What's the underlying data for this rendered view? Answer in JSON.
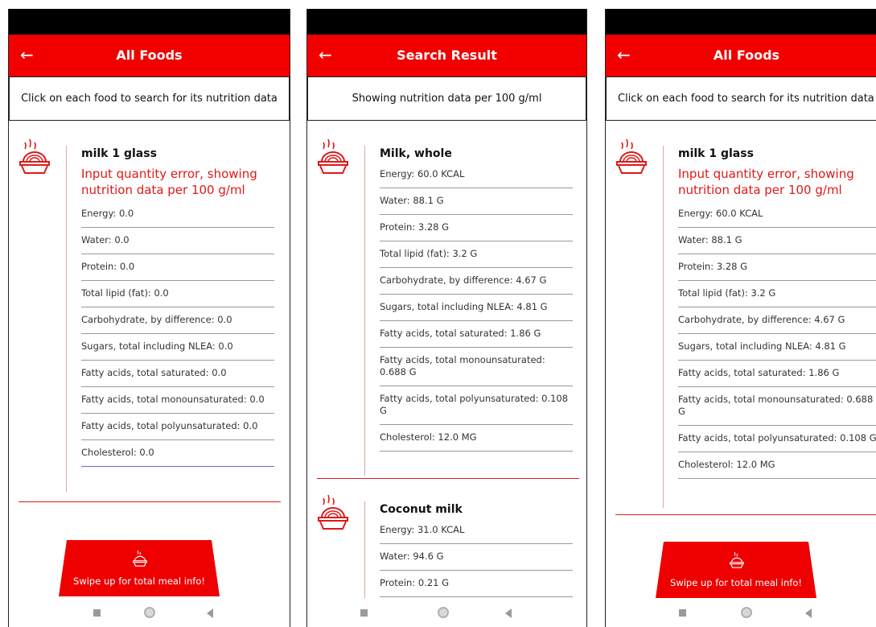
{
  "phone1": {
    "title": "All Foods",
    "subheader": "Click on each food to search for its nutrition data",
    "food": {
      "name": "milk 1 glass",
      "error": "Input quantity error, showing nutrition data per 100 g/ml",
      "rows": [
        "Energy: 0.0",
        "Water: 0.0",
        "Protein: 0.0",
        "Total lipid (fat): 0.0",
        "Carbohydrate, by difference: 0.0",
        "Sugars, total including NLEA: 0.0",
        "Fatty acids, total saturated: 0.0",
        "Fatty acids, total monounsaturated: 0.0",
        "Fatty acids, total polyunsaturated: 0.0",
        "Cholesterol: 0.0"
      ]
    },
    "swipe_label": "Swipe up for total meal info!"
  },
  "phone2": {
    "title": "Search Result",
    "subheader": "Showing nutrition data per 100 g/ml",
    "food1": {
      "name": "Milk, whole",
      "rows": [
        "Energy: 60.0 KCAL",
        "Water: 88.1 G",
        "Protein: 3.28 G",
        "Total lipid (fat): 3.2 G",
        "Carbohydrate, by difference: 4.67 G",
        "Sugars, total including NLEA: 4.81 G",
        "Fatty acids, total saturated: 1.86 G",
        "Fatty acids, total monounsaturated: 0.688 G",
        "Fatty acids, total polyunsaturated: 0.108 G",
        "Cholesterol: 12.0 MG"
      ]
    },
    "food2": {
      "name": "Coconut milk",
      "rows": [
        "Energy: 31.0 KCAL",
        "Water: 94.6 G",
        "Protein: 0.21 G"
      ]
    }
  },
  "phone3": {
    "title": "All Foods",
    "subheader": "Click on each food to search for its nutrition data",
    "food": {
      "name": "milk 1 glass",
      "error": "Input quantity error, showing nutrition data per 100 g/ml",
      "rows": [
        "Energy: 60.0 KCAL",
        "Water: 88.1 G",
        "Protein: 3.28 G",
        "Total lipid (fat): 3.2 G",
        "Carbohydrate, by difference: 4.67 G",
        "Sugars, total including NLEA: 4.81 G",
        "Fatty acids, total saturated: 1.86 G",
        "Fatty acids, total monounsaturated: 0.688 G",
        "Fatty acids, total polyunsaturated: 0.108 G",
        "Cholesterol: 12.0 MG"
      ]
    },
    "swipe_label": "Swipe up for total meal info!"
  },
  "icons": {
    "back": "arrow-left-icon",
    "food": "noodle-bowl-icon",
    "nav_recent": "square-icon",
    "nav_home": "circle-icon",
    "nav_back": "triangle-left-icon"
  },
  "colors": {
    "accent": "#f20000",
    "error_text": "#e01818"
  }
}
